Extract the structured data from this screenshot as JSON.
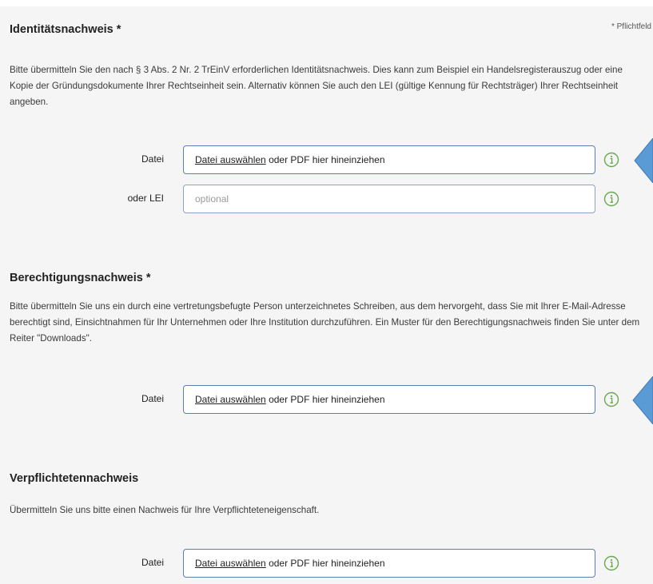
{
  "required_note": "* Pflichtfeld",
  "sections": [
    {
      "title": "Identitätsnachweis *",
      "description": "Bitte übermitteln Sie den nach § 3 Abs. 2 Nr. 2 TrEinV erforderlichen Identitätsnachweis. Dies kann zum Beispiel ein Handelsregisterauszug oder eine Kopie der Gründungsdokumente Ihrer Rechtseinheit sein. Alternativ können Sie auch den LEI (gültige Kennung für Rechtsträger) Ihrer Rechtseinheit angeben.",
      "file_label": "Datei",
      "file_link": "Datei auswählen",
      "file_hint": " oder PDF hier hineinziehen",
      "lei_label": "oder LEI",
      "lei_placeholder": "optional",
      "lei_value": ""
    },
    {
      "title": "Berechtigungsnachweis *",
      "description": "Bitte übermitteln Sie uns ein durch eine vertretungsbefugte Person unterzeichnetes Schreiben, aus dem hervorgeht, dass Sie mit Ihrer E-Mail-Adresse berechtigt sind, Einsichtnahmen für Ihr Unternehmen oder Ihre Institution durchzuführen. Ein Muster für den Berechtigungsnachweis finden Sie unter dem Reiter \"Downloads\".",
      "file_label": "Datei",
      "file_link": "Datei auswählen",
      "file_hint": " oder PDF hier hineinziehen"
    },
    {
      "title": "Verpflichtetennachweis",
      "description": "Übermitteln Sie uns bitte einen Nachweis für Ihre Verpflichteteneigenschaft.",
      "file_label": "Datei",
      "file_link": "Datei auswählen",
      "file_hint": " oder PDF hier hineinziehen"
    }
  ],
  "colors": {
    "panel_bg": "#f5f5f5",
    "field_border": "#5a7fb5",
    "info_icon": "#6aa84f",
    "tooltip_arrow": "#5b9bd5"
  },
  "icons": {
    "info": "info-circle-icon",
    "tooltip": "tooltip-pointer-icon"
  }
}
